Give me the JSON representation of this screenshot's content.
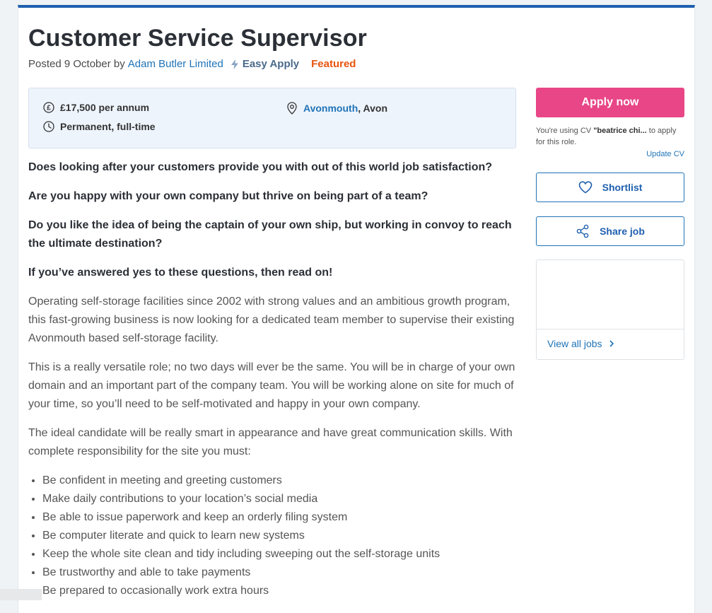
{
  "job": {
    "title": "Customer Service Supervisor",
    "posted_prefix": "Posted 9 October by",
    "company": "Adam Butler Limited",
    "easy_apply": "Easy Apply",
    "featured": "Featured"
  },
  "info": {
    "salary": "£17,500 per annum",
    "job_type": "Permanent, full-time",
    "location_link": "Avonmouth",
    "location_rest": ", Avon"
  },
  "description": {
    "questions": [
      "Does looking after your customers provide you with out of this world job satisfaction?",
      "Are you happy with your own company but thrive on being part of a team?",
      "Do you like the idea of being the captain of your own ship, but working in convoy to reach the ultimate destination?",
      "If you’ve answered yes to these questions, then read on!"
    ],
    "paragraphs": [
      "Operating self-storage facilities since 2002 with strong values and an ambitious growth program, this fast-growing business is now looking for a dedicated team member to supervise their existing Avonmouth based self-storage facility.",
      "This is a really versatile role; no two days will ever be the same. You will be in charge of your own domain and an important part of the company team. You will be working alone on site for much of your time, so you’ll need to be self-motivated and happy in your own company.",
      "The ideal candidate will be really smart in appearance and have great communication skills. With complete responsibility for the site you must:"
    ],
    "bullets": [
      "Be confident in meeting and greeting customers",
      "Make daily contributions to your location’s social media",
      "Be able to issue paperwork and keep an orderly filing system",
      "Be computer literate and quick to learn new systems",
      "Keep the whole site clean and tidy including sweeping out the self-storage units",
      "Be trustworthy and able to take payments",
      "Be prepared to occasionally work extra hours"
    ]
  },
  "sidebar": {
    "apply_label": "Apply now",
    "cv_prefix": "You're using CV ",
    "cv_name": "\"beatrice chi...",
    "cv_suffix": " to apply for this role.",
    "update_cv": "Update CV",
    "shortlist_label": "Shortlist",
    "share_label": "Share job",
    "view_all_label": "View all jobs"
  },
  "colors": {
    "accent_blue": "#1f73b7",
    "apply_pink": "#e84687",
    "featured_orange": "#e8530e",
    "top_border": "#1f5fae"
  },
  "icons": {
    "salary": "pound-icon",
    "job_type": "clock-icon",
    "location": "location-pin-icon",
    "easy_apply": "lightning-icon",
    "shortlist": "heart-icon",
    "share": "share-icon",
    "view_all": "chevron-right-icon"
  }
}
